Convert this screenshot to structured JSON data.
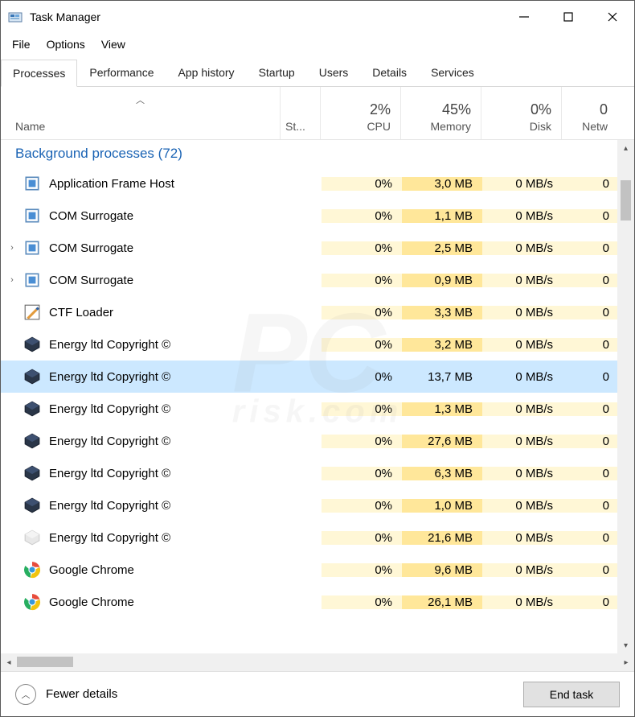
{
  "title": "Task Manager",
  "menu": {
    "file": "File",
    "options": "Options",
    "view": "View"
  },
  "tabs": [
    "Processes",
    "Performance",
    "App history",
    "Startup",
    "Users",
    "Details",
    "Services"
  ],
  "active_tab": 0,
  "headers": {
    "name": "Name",
    "sort_indicator": "︿",
    "status": "St...",
    "cpu": {
      "val": "2%",
      "label": "CPU"
    },
    "memory": {
      "val": "45%",
      "label": "Memory"
    },
    "disk": {
      "val": "0%",
      "label": "Disk"
    },
    "network": {
      "val": "0",
      "label": "Netw"
    }
  },
  "group": {
    "label": "Background processes (72)"
  },
  "rows": [
    {
      "expand": "",
      "icon": "frame",
      "name": "Application Frame Host",
      "cpu": "0%",
      "mem": "3,0 MB",
      "disk": "0 MB/s",
      "net": "0",
      "sel": false
    },
    {
      "expand": "",
      "icon": "frame",
      "name": "COM Surrogate",
      "cpu": "0%",
      "mem": "1,1 MB",
      "disk": "0 MB/s",
      "net": "0",
      "sel": false
    },
    {
      "expand": "›",
      "icon": "frame",
      "name": "COM Surrogate",
      "cpu": "0%",
      "mem": "2,5 MB",
      "disk": "0 MB/s",
      "net": "0",
      "sel": false
    },
    {
      "expand": "›",
      "icon": "frame",
      "name": "COM Surrogate",
      "cpu": "0%",
      "mem": "0,9 MB",
      "disk": "0 MB/s",
      "net": "0",
      "sel": false
    },
    {
      "expand": "",
      "icon": "ctf",
      "name": "CTF Loader",
      "cpu": "0%",
      "mem": "3,3 MB",
      "disk": "0 MB/s",
      "net": "0",
      "sel": false
    },
    {
      "expand": "",
      "icon": "hex",
      "name": "Energy ltd Copyright ©",
      "cpu": "0%",
      "mem": "3,2 MB",
      "disk": "0 MB/s",
      "net": "0",
      "sel": false
    },
    {
      "expand": "",
      "icon": "hex",
      "name": "Energy ltd Copyright ©",
      "cpu": "0%",
      "mem": "13,7 MB",
      "disk": "0 MB/s",
      "net": "0",
      "sel": true
    },
    {
      "expand": "",
      "icon": "hex",
      "name": "Energy ltd Copyright ©",
      "cpu": "0%",
      "mem": "1,3 MB",
      "disk": "0 MB/s",
      "net": "0",
      "sel": false
    },
    {
      "expand": "",
      "icon": "hex",
      "name": "Energy ltd Copyright ©",
      "cpu": "0%",
      "mem": "27,6 MB",
      "disk": "0 MB/s",
      "net": "0",
      "sel": false
    },
    {
      "expand": "",
      "icon": "hex",
      "name": "Energy ltd Copyright ©",
      "cpu": "0%",
      "mem": "6,3 MB",
      "disk": "0 MB/s",
      "net": "0",
      "sel": false
    },
    {
      "expand": "",
      "icon": "hex",
      "name": "Energy ltd Copyright ©",
      "cpu": "0%",
      "mem": "1,0 MB",
      "disk": "0 MB/s",
      "net": "0",
      "sel": false
    },
    {
      "expand": "",
      "icon": "hexg",
      "name": "Energy ltd Copyright ©",
      "cpu": "0%",
      "mem": "21,6 MB",
      "disk": "0 MB/s",
      "net": "0",
      "sel": false
    },
    {
      "expand": "",
      "icon": "chrome",
      "name": "Google Chrome",
      "cpu": "0%",
      "mem": "9,6 MB",
      "disk": "0 MB/s",
      "net": "0",
      "sel": false
    },
    {
      "expand": "",
      "icon": "chrome",
      "name": "Google Chrome",
      "cpu": "0%",
      "mem": "26,1 MB",
      "disk": "0 MB/s",
      "net": "0",
      "sel": false
    }
  ],
  "footer": {
    "fewer": "Fewer details",
    "end": "End task"
  },
  "watermark": {
    "main": "PC",
    "sub": "risk.com"
  }
}
